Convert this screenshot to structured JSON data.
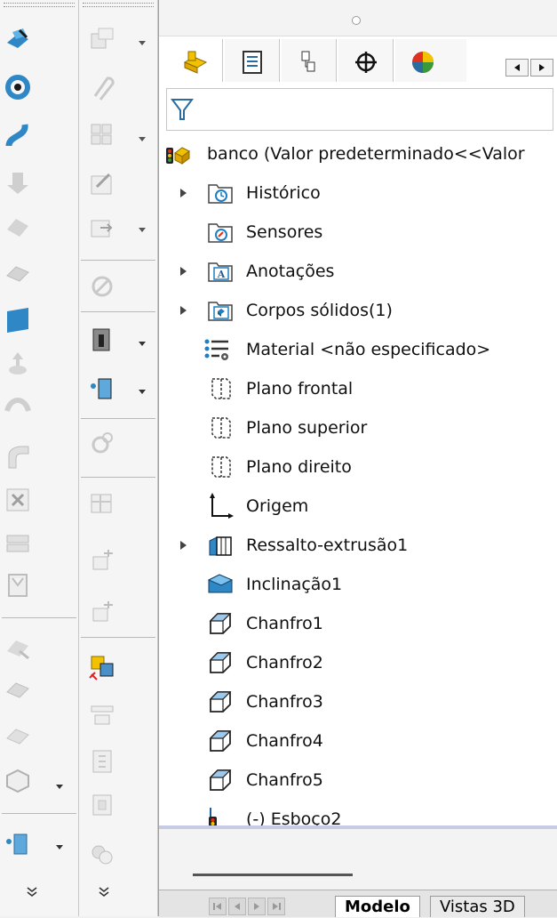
{
  "tree": {
    "root": {
      "label": "banco  (Valor predeterminado<<Valor"
    },
    "items": [
      {
        "label": "Histórico"
      },
      {
        "label": "Sensores"
      },
      {
        "label": "Anotações"
      },
      {
        "label": "Corpos sólidos(1)"
      },
      {
        "label": "Material <não especificado>"
      },
      {
        "label": "Plano frontal"
      },
      {
        "label": "Plano superior"
      },
      {
        "label": "Plano direito"
      },
      {
        "label": "Origem"
      },
      {
        "label": "Ressalto-extrusão1"
      },
      {
        "label": "Inclinação1"
      },
      {
        "label": "Chanfro1"
      },
      {
        "label": "Chanfro2"
      },
      {
        "label": "Chanfro3"
      },
      {
        "label": "Chanfro4"
      },
      {
        "label": "Chanfro5"
      },
      {
        "label": "(-) Esboço2"
      }
    ]
  },
  "bottom_tabs": {
    "modelo": "Modelo",
    "vistas": "Vistas 3D"
  },
  "panel_tabs": [
    "feature-manager",
    "property-manager",
    "configuration-manager",
    "dimxpert-manager",
    "display-manager"
  ],
  "colors": {
    "accent_blue": "#2f87c5",
    "folder_blue": "#1c7fc4",
    "splitter": "#c7cbe6"
  }
}
